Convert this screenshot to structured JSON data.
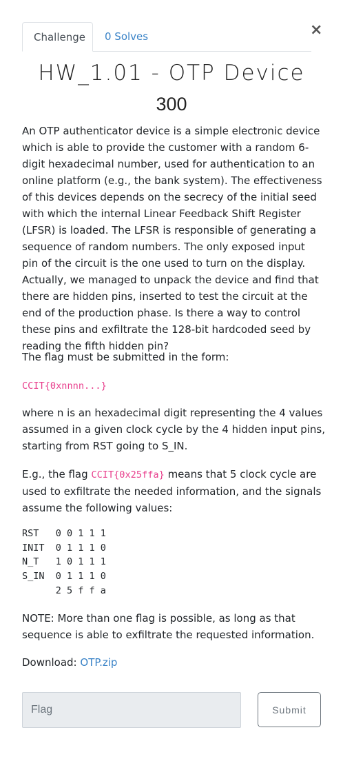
{
  "modal": {
    "close_label": "×"
  },
  "tabs": [
    {
      "label": "Challenge"
    },
    {
      "label": "0 Solves"
    }
  ],
  "challenge": {
    "title": "HW_1.01 - OTP Device",
    "points": "300",
    "description": "An OTP authenticator device is a simple electronic device which is able to provide the customer with a random 6-digit hexadecimal number, used for authentication to an online platform (e.g., the bank system). The effectiveness of this devices depends on the secrecy of the initial seed with which the internal Linear Feedback Shift Register (LFSR) is loaded. The LFSR is responsible of generating a sequence of random numbers. The only exposed input pin of the circuit is the one used to turn on the display. Actually, we managed to unpack the device and find that there are hidden pins, inserted to test the circuit at the end of the production phase. Is there a way to control these pins and exfiltrate the 128-bit hardcoded seed by reading the fifth hidden pin?",
    "flag_form_text": "The flag must be submitted in the form:",
    "flag_format": "CCIT{0xnnnn...}",
    "where_text": "where n is an hexadecimal digit representing the 4 values assumed in a given clock cycle by the 4 hidden input pins, starting from RST going to S_IN.",
    "example_prefix": "E.g., the flag ",
    "example_flag": "CCIT{0x25ffa}",
    "example_suffix": " means that 5 clock cycle are used to exfiltrate the needed information, and the signals assume the following values:",
    "signals": "RST   0 0 1 1 1\nINIT  0 1 1 1 0\nN_T   1 0 1 1 1\nS_IN  0 1 1 1 0\n      2 5 f f a",
    "note": "NOTE: More than one flag is possible, as long as that sequence is able to exfiltrate the requested information.",
    "download_label": "Download: ",
    "download_file": "OTP.zip"
  },
  "form": {
    "flag_placeholder": "Flag",
    "submit_label": "Submit"
  }
}
